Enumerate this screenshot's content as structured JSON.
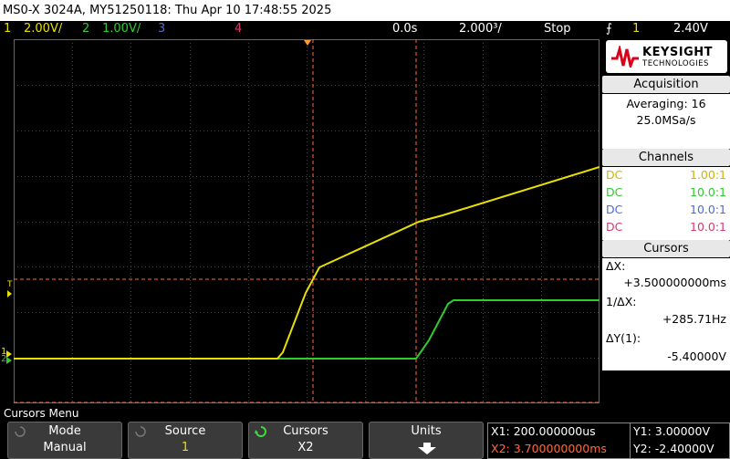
{
  "title_bar": {
    "text": "MS0-X 3024A, MY51250118: Thu Apr 10 17:48:55 2025"
  },
  "channel_bar": {
    "ch1": {
      "num": "1",
      "scale": "2.00V/",
      "color": "#e8e000"
    },
    "ch2": {
      "num": "2",
      "scale": "1.00V/",
      "color": "#2ecc2e"
    },
    "ch3": {
      "num": "3",
      "color": "#4b6bd6"
    },
    "ch4": {
      "num": "4",
      "color": "#d83a6a"
    },
    "time_pos": "0.0s",
    "time_scale": "2.000³/",
    "run_state": "Stop",
    "trigger_icon": "trigger-edge-icon",
    "trigger_ch": "1",
    "trigger_level": "2.40V"
  },
  "logo": {
    "name": "KEYSIGHT",
    "sub": "TECHNOLOGIES"
  },
  "acquisition": {
    "header": "Acquisition",
    "mode": "Averaging: 16",
    "rate": "25.0MSa/s"
  },
  "channels": {
    "header": "Channels",
    "rows": [
      {
        "coupling": "DC",
        "probe": "1.00:1",
        "color": "#e8e000"
      },
      {
        "coupling": "DC",
        "probe": "10.0:1",
        "color": "#2ecc2e"
      },
      {
        "coupling": "DC",
        "probe": "10.0:1",
        "color": "#4b6bd6"
      },
      {
        "coupling": "DC",
        "probe": "10.0:1",
        "color": "#d83a6a"
      }
    ]
  },
  "cursors_panel": {
    "header": "Cursors",
    "dx_label": "ΔX:",
    "dx_value": "+3.500000000ms",
    "inv_dx_label": "1/ΔX:",
    "inv_dx_value": "+285.71Hz",
    "dy_label": "ΔY(1):",
    "dy_value": "-5.40000V"
  },
  "menu_title": "Cursors Menu",
  "softkeys": [
    {
      "label": "Mode",
      "value": "Manual"
    },
    {
      "label": "Source",
      "value": "1"
    },
    {
      "label": "Cursors",
      "value": "X2"
    },
    {
      "label": "Units",
      "value": ""
    }
  ],
  "cursor_readout": {
    "x1": "X1: 200.000000us",
    "x2": "X2: 3.700000000ms",
    "y1": "Y1: 3.00000V",
    "y2": "Y2: -2.40000V"
  },
  "colors": {
    "cursor": "#ff6a3d",
    "grid": "#4a4a4a",
    "ch1": "#e8e000",
    "ch2": "#2ecc2e"
  }
}
